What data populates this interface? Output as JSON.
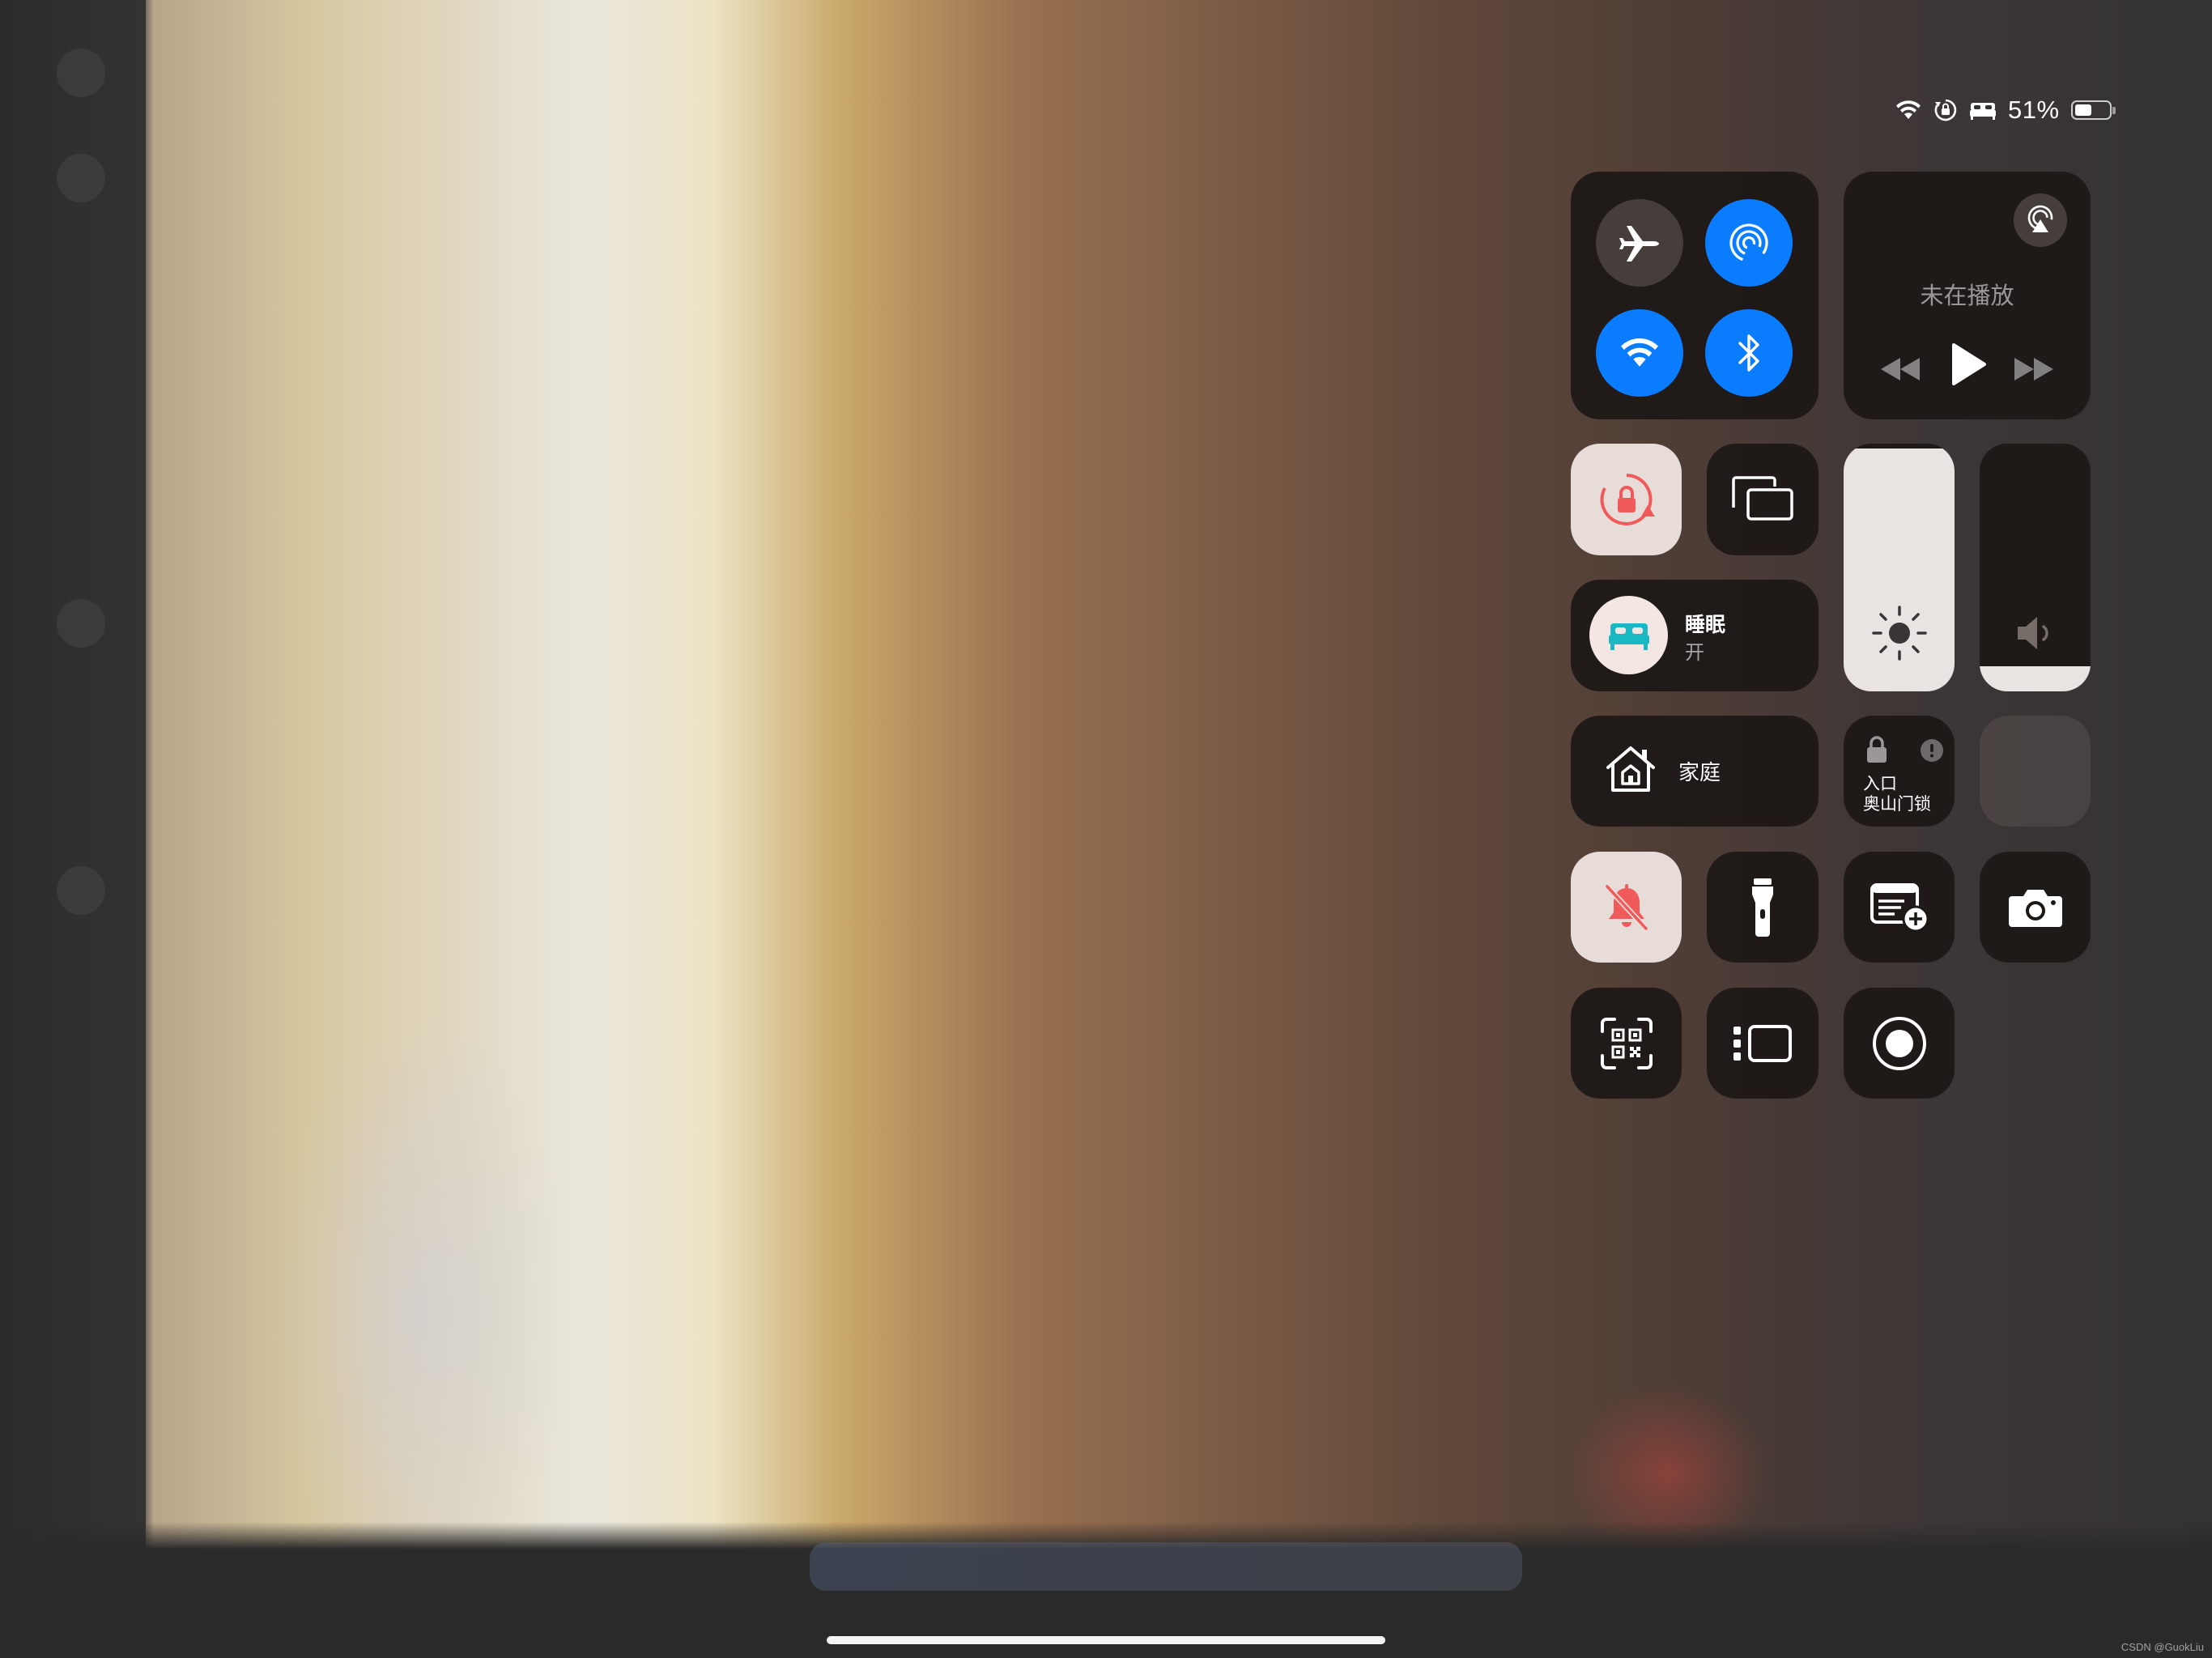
{
  "status_bar": {
    "battery_percent": "51%",
    "battery_level": 0.51,
    "icons": [
      "wifi-icon",
      "orientation-lock-icon",
      "sleep-bed-icon",
      "battery-icon"
    ]
  },
  "connectivity": {
    "airplane_mode": {
      "icon": "airplane-icon",
      "on": false
    },
    "airdrop": {
      "icon": "airdrop-icon",
      "on": true
    },
    "wifi": {
      "icon": "wifi-icon",
      "on": true
    },
    "bluetooth": {
      "icon": "bluetooth-icon",
      "on": true
    }
  },
  "now_playing": {
    "status": "未在播放",
    "icons": [
      "airplay-icon",
      "rewind-icon",
      "play-icon",
      "fast-forward-icon"
    ]
  },
  "orientation_lock": {
    "icon": "orientation-lock-icon",
    "on": true
  },
  "screen_mirroring": {
    "icon": "screen-mirroring-icon"
  },
  "sleep_focus": {
    "title": "睡眠",
    "state": "开",
    "icon": "bed-icon",
    "accent": "#19b8c2"
  },
  "brightness": {
    "icon": "sun-icon",
    "level": 0.98
  },
  "volume": {
    "icon": "speaker-icon",
    "level": 0.1
  },
  "home": {
    "label": "家庭",
    "icon": "home-icon"
  },
  "door_lock": {
    "line1": "入口",
    "line2": "奥山门锁",
    "icons": [
      "lock-icon",
      "alert-icon"
    ]
  },
  "silent_mode": {
    "icon": "bell-slash-icon",
    "on": true,
    "accent": "#ff5a5a"
  },
  "flashlight": {
    "icon": "flashlight-icon"
  },
  "quick_note": {
    "icon": "quick-note-icon"
  },
  "camera": {
    "icon": "camera-icon"
  },
  "code_scanner": {
    "icon": "qr-code-scanner-icon"
  },
  "stage_manager": {
    "icon": "stage-manager-icon"
  },
  "screen_recording": {
    "icon": "screen-record-icon"
  },
  "watermark": "CSDN @GuokLiu",
  "colors": {
    "blue": "#0a7cff",
    "tile": "#1c1816",
    "active_light": "#e8dcd8",
    "red_accent": "#ff5a5a"
  }
}
